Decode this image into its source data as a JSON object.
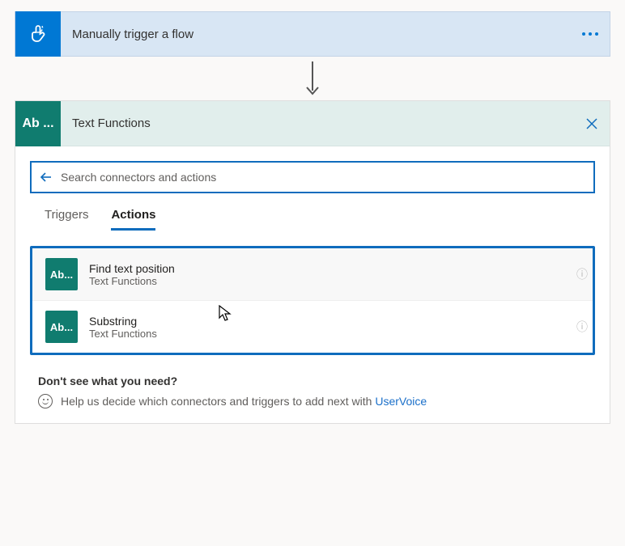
{
  "trigger": {
    "title": "Manually trigger a flow"
  },
  "action_card": {
    "title": "Text Functions",
    "icon_label": "Ab ..."
  },
  "search": {
    "placeholder": "Search connectors and actions"
  },
  "tabs": {
    "triggers": "Triggers",
    "actions": "Actions"
  },
  "actions": [
    {
      "title": "Find text position",
      "subtitle": "Text Functions",
      "icon_label": "Ab..."
    },
    {
      "title": "Substring",
      "subtitle": "Text Functions",
      "icon_label": "Ab..."
    }
  ],
  "help": {
    "title": "Don't see what you need?",
    "text": "Help us decide which connectors and triggers to add next with ",
    "link": "UserVoice"
  },
  "colors": {
    "brand_blue": "#0f6cbd",
    "teal": "#107c6f"
  }
}
